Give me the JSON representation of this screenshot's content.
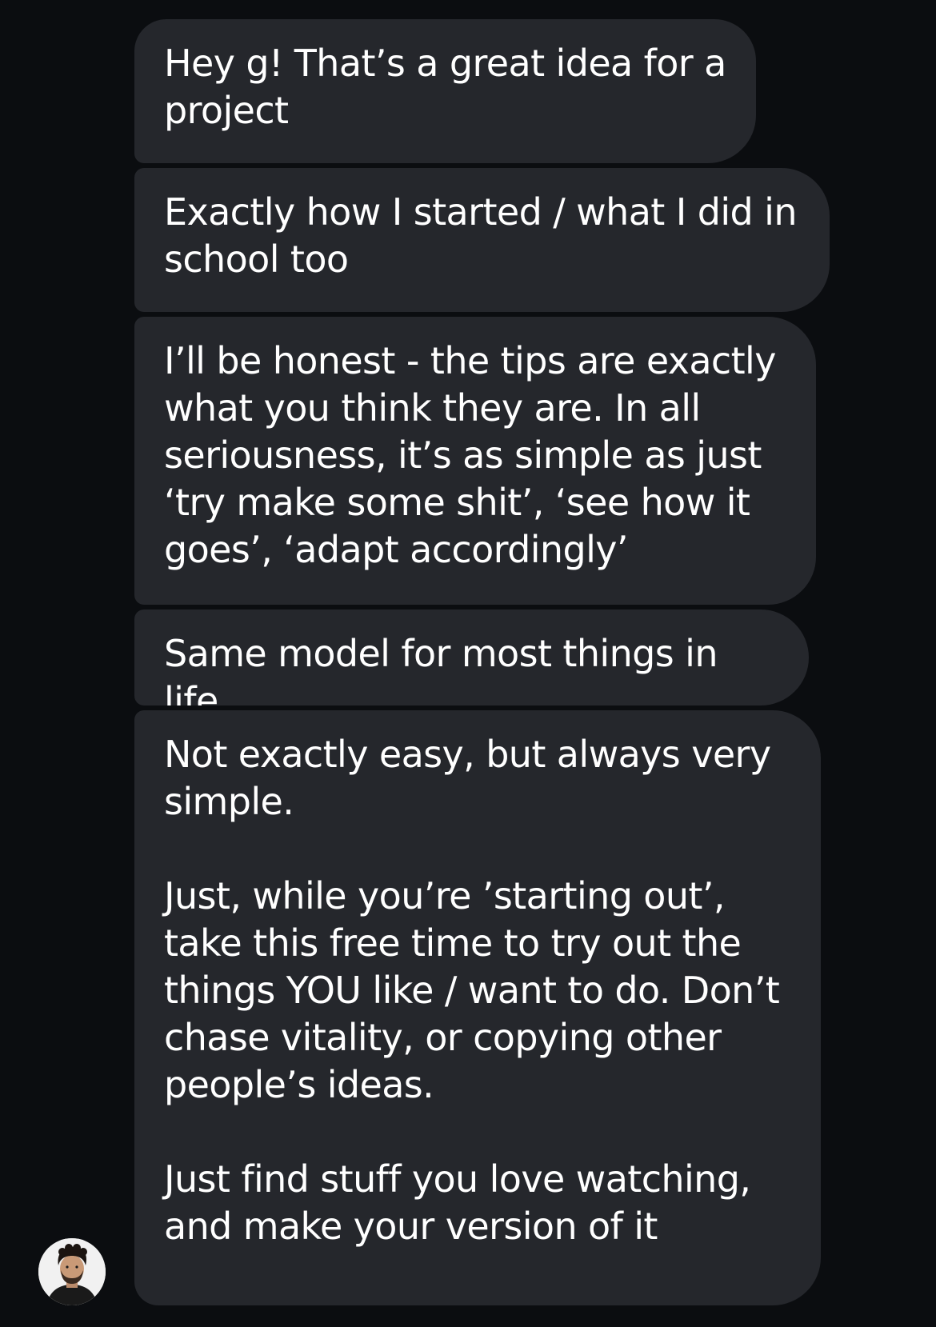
{
  "thread": {
    "messages": [
      {
        "text": "Hey g! That’s a great idea for a project"
      },
      {
        "text": "Exactly how I started / what I did in school too"
      },
      {
        "text": "I’ll be honest - the tips are exactly what you think they are. In all seriousness, it’s as simple as just ‘try make some shit’, ‘see how it goes’, ‘adapt accordingly’"
      },
      {
        "text": "Same model for most things in life"
      },
      {
        "text": "Not exactly easy, but always very simple.\n\nJust, while you’re ’starting out’, take this free time to try out the things YOU like / want to do. Don’t chase vitality, or copying other people’s ideas.\n\nJust find stuff you love watching, and make your version of it"
      }
    ]
  },
  "colors": {
    "background": "#0b0d10",
    "bubble": "#25272c",
    "text": "#ffffff"
  },
  "icons": {
    "avatar": "user-avatar-icon"
  }
}
